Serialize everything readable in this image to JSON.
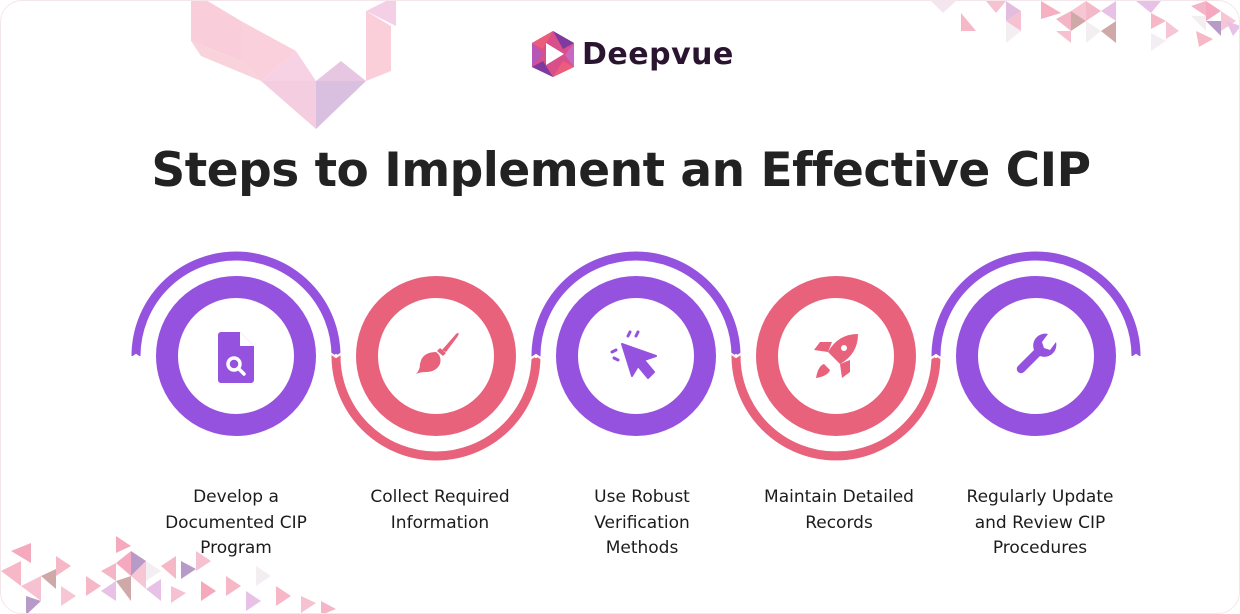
{
  "brand": {
    "name": "Deepvue",
    "logo_icon": "hexagon-play-logo-icon"
  },
  "title": "Steps to Implement an Effective CIP",
  "colors": {
    "purple": "#9552df",
    "pink": "#e8627c",
    "title": "#222222",
    "brand_text": "#2a1430"
  },
  "steps": [
    {
      "label": "Develop a\nDocumented CIP\nProgram",
      "icon": "file-search-icon",
      "color": "purple"
    },
    {
      "label": "Collect Required\nInformation",
      "icon": "paintbrush-icon",
      "color": "pink"
    },
    {
      "label": "Use Robust\nVerification\nMethods",
      "icon": "cursor-click-icon",
      "color": "purple"
    },
    {
      "label": "Maintain Detailed\nRecords",
      "icon": "rocket-icon",
      "color": "pink"
    },
    {
      "label": "Regularly Update\nand Review CIP\nProcedures",
      "icon": "wrench-icon",
      "color": "purple"
    }
  ]
}
